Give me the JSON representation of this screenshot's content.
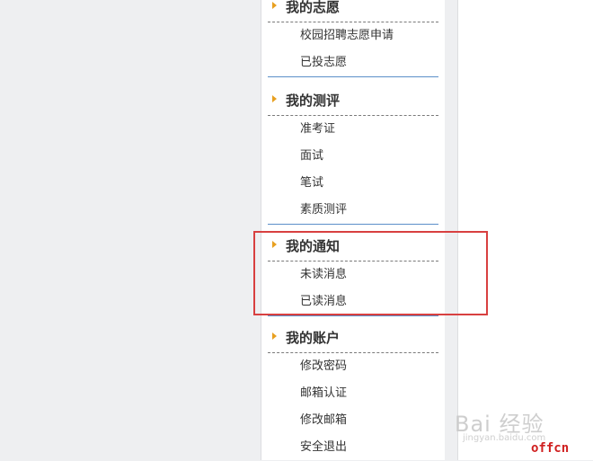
{
  "accent_color": "#e8a020",
  "separator_color": "#5b8fc9",
  "highlight_color": "#d84040",
  "sidebar": {
    "sections": [
      {
        "icon": "chevron-right-icon",
        "title": "我的志愿",
        "items": [
          "校园招聘志愿申请",
          "已投志愿"
        ]
      },
      {
        "icon": "chevron-right-icon",
        "title": "我的测评",
        "items": [
          "准考证",
          "面试",
          "笔试",
          "素质测评"
        ]
      },
      {
        "icon": "chevron-right-icon",
        "title": "我的通知",
        "items": [
          "未读消息",
          "已读消息"
        ]
      },
      {
        "icon": "chevron-right-icon",
        "title": "我的账户",
        "items": [
          "修改密码",
          "邮箱认证",
          "修改邮箱",
          "安全退出"
        ]
      }
    ]
  },
  "watermark": {
    "brand": "Bai 经验",
    "url": "jingyan.baidu.com",
    "logo_text": "offcn"
  }
}
